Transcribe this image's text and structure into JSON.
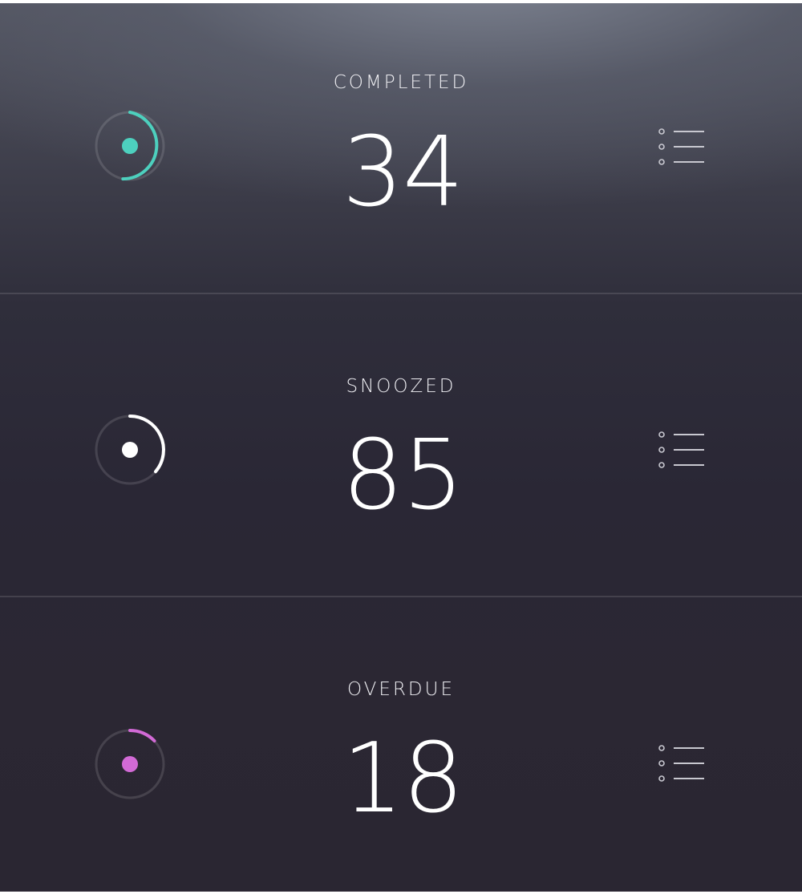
{
  "stats": [
    {
      "label": "COMPLETED",
      "value": "34",
      "color": "#4dd0be",
      "ring_icon": "progress-ring-icon",
      "menu_icon": "list-icon"
    },
    {
      "label": "SNOOZED",
      "value": "85",
      "color": "#ffffff",
      "ring_icon": "progress-ring-icon",
      "menu_icon": "list-icon"
    },
    {
      "label": "OVERDUE",
      "value": "18",
      "color": "#d26ad6",
      "ring_icon": "progress-ring-icon",
      "menu_icon": "list-icon"
    }
  ]
}
